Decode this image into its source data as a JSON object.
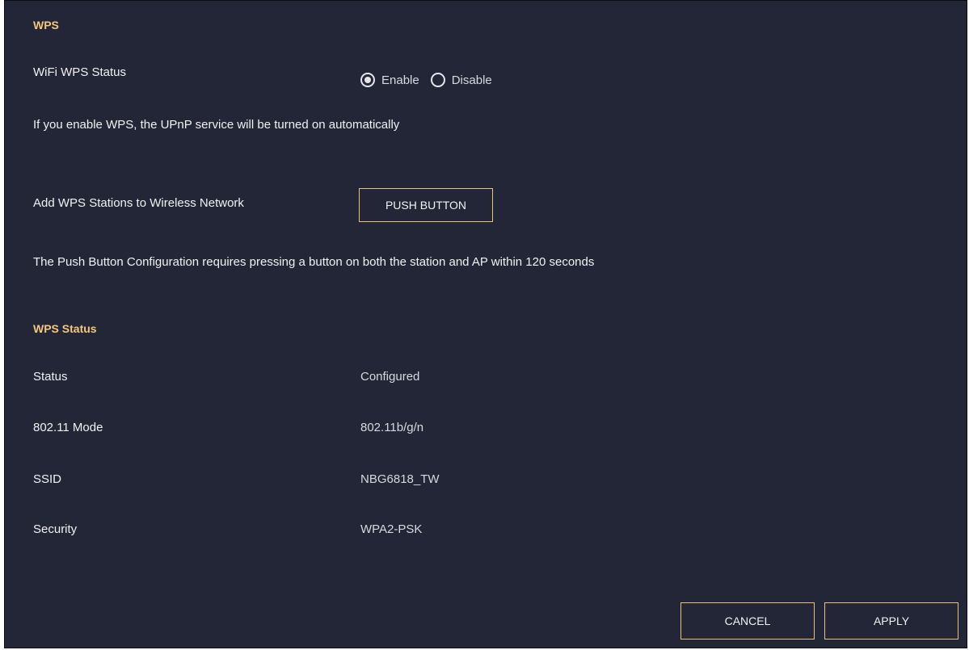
{
  "wps": {
    "title": "WPS",
    "status_label": "WiFi WPS Status",
    "options": [
      {
        "label": "Enable",
        "selected": true
      },
      {
        "label": "Disable",
        "selected": false
      }
    ],
    "note": "If you enable WPS, the UPnP service will be turned on automatically",
    "add_label": "Add WPS Stations to Wireless Network",
    "push_button": "PUSH BUTTON",
    "push_note": "The Push Button Configuration requires pressing a button on both the station and AP within 120 seconds"
  },
  "wps_status": {
    "title": "WPS Status",
    "rows": [
      {
        "label": "Status",
        "value": "Configured"
      },
      {
        "label": "802.11 Mode",
        "value": "802.11b/g/n"
      },
      {
        "label": "SSID",
        "value": "NBG6818_TW"
      },
      {
        "label": "Security",
        "value": "WPA2-PSK"
      }
    ]
  },
  "footer": {
    "cancel": "CANCEL",
    "apply": "APPLY"
  },
  "colors": {
    "background": "#232637",
    "accent": "#f3c87a",
    "button_border": "#e8c07a"
  }
}
